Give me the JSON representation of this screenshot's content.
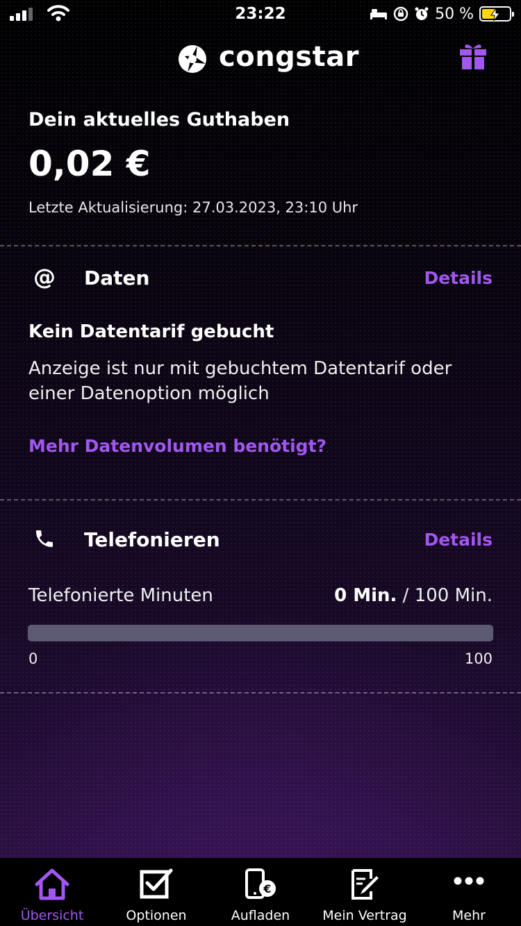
{
  "status_bar": {
    "time": "23:22",
    "battery_percent": "50 %",
    "battery_level": 0.5,
    "icons": [
      "signal-icon",
      "wifi-icon",
      "sleep-icon",
      "rotation-lock-icon",
      "alarm-icon",
      "battery-charging-icon"
    ]
  },
  "header": {
    "logo_text": "congstar",
    "logo_icon": "congstar-logo-icon",
    "gift_icon": "gift-icon"
  },
  "balance": {
    "title": "Dein aktuelles Guthaben",
    "amount": "0,02 €",
    "updated": "Letzte Aktualisierung: 27.03.2023, 23:10 Uhr"
  },
  "data_section": {
    "icon": "at-icon",
    "icon_glyph": "@",
    "title": "Daten",
    "details_label": "Details",
    "no_plan_title": "Kein Datentarif gebucht",
    "no_plan_desc": "Anzeige ist nur mit gebuchtem Datentarif oder einer Datenoption möglich",
    "more_data_link": "Mehr Datenvolumen benötigt?"
  },
  "phone_section": {
    "icon": "phone-icon",
    "title": "Telefonieren",
    "details_label": "Details",
    "minutes_label": "Telefonierte Minuten",
    "used": "0 Min.",
    "separator": "/",
    "total": "100 Min.",
    "used_fraction": 0,
    "scale_min": "0",
    "scale_max": "100"
  },
  "tabbar": {
    "active_color": "#a157f0",
    "items": [
      {
        "label": "Übersicht",
        "icon": "home-icon",
        "active": true
      },
      {
        "label": "Optionen",
        "icon": "checkbox-icon",
        "active": false
      },
      {
        "label": "Aufladen",
        "icon": "phone-euro-icon",
        "active": false
      },
      {
        "label": "Mein Vertrag",
        "icon": "contract-edit-icon",
        "active": false
      },
      {
        "label": "Mehr",
        "icon": "more-dots-icon",
        "active": false
      }
    ]
  },
  "colors": {
    "accent": "#a157f0",
    "background": "#000000",
    "progress_track": "#5c5b73"
  }
}
